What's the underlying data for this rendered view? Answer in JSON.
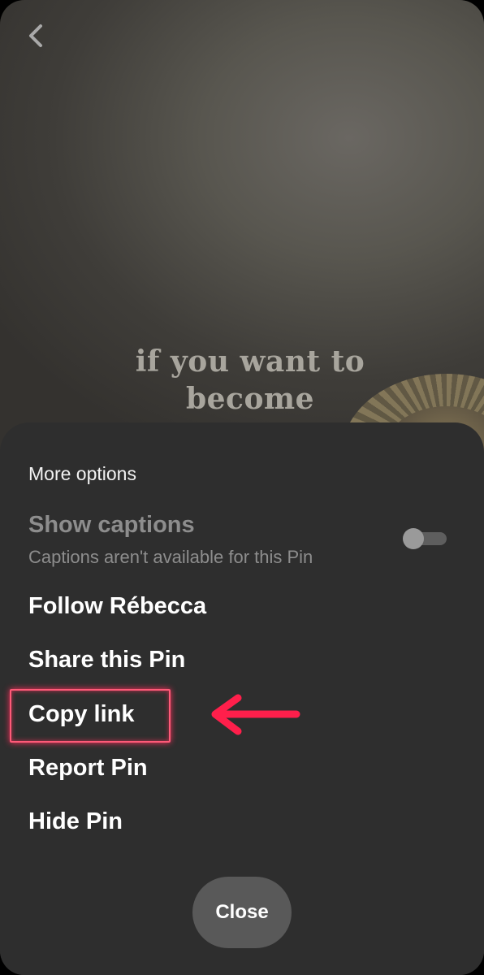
{
  "pin": {
    "caption_line1": "if you want to",
    "caption_line2": "become"
  },
  "icons": {
    "back": "chevron-left-icon",
    "annotation_arrow": "arrow-left-icon"
  },
  "sheet": {
    "title": "More options",
    "show_captions": {
      "label": "Show captions",
      "description": "Captions aren't available for this Pin",
      "enabled": false
    },
    "items": [
      {
        "label": "Follow Rébecca"
      },
      {
        "label": "Share this Pin"
      },
      {
        "label": "Copy link"
      },
      {
        "label": "Report Pin"
      },
      {
        "label": "Hide Pin"
      }
    ],
    "close_label": "Close"
  },
  "colors": {
    "sheet_background": "#2e2e2e",
    "close_button": "#595959",
    "annotation": "#ff1f4b",
    "disabled_text": "#8d8d8d"
  }
}
